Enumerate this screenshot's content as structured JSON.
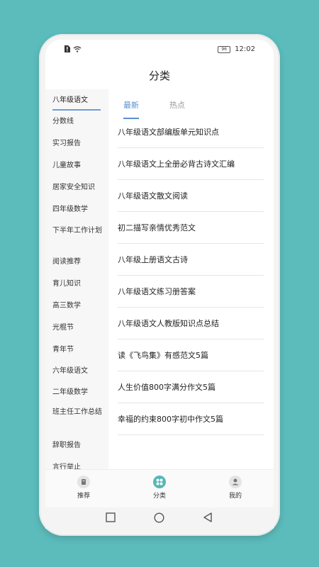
{
  "status_bar": {
    "time": "12:02",
    "battery": "96"
  },
  "header": {
    "title": "分类"
  },
  "sidebar": {
    "items": [
      {
        "label": "八年级语文"
      },
      {
        "label": "分数线"
      },
      {
        "label": "实习报告"
      },
      {
        "label": "儿童故事"
      },
      {
        "label": "居家安全知识"
      },
      {
        "label": "四年级数学"
      },
      {
        "label": "下半年工作计划"
      },
      {
        "label": "阅读推荐"
      },
      {
        "label": "育儿知识"
      },
      {
        "label": "高三数学"
      },
      {
        "label": "光棍节"
      },
      {
        "label": "青年节"
      },
      {
        "label": "六年级语文"
      },
      {
        "label": "二年级数学"
      },
      {
        "label": "班主任工作总结"
      },
      {
        "label": "辞职报告"
      },
      {
        "label": "言行举止"
      }
    ]
  },
  "tabs": [
    {
      "label": "最新"
    },
    {
      "label": "热点"
    }
  ],
  "articles": [
    {
      "title": "八年级语文部编版单元知识点"
    },
    {
      "title": "八年级语文上全册必背古诗文汇编"
    },
    {
      "title": "八年级语文散文阅读"
    },
    {
      "title": "初二描写亲情优秀范文"
    },
    {
      "title": "八年级上册语文古诗"
    },
    {
      "title": "八年级语文练习册答案"
    },
    {
      "title": "八年级语文人教版知识点总结"
    },
    {
      "title": "读《飞鸟集》有感范文5篇"
    },
    {
      "title": "人生价值800字满分作文5篇"
    },
    {
      "title": "幸福的约束800字初中作文5篇"
    }
  ],
  "bottom_nav": [
    {
      "label": "推荐",
      "icon": "recommend-icon"
    },
    {
      "label": "分类",
      "icon": "category-icon"
    },
    {
      "label": "我的",
      "icon": "profile-icon"
    }
  ],
  "colors": {
    "background": "#5cbcbc",
    "accent": "#5b8fd0",
    "nav_active": "#56b6b6"
  }
}
